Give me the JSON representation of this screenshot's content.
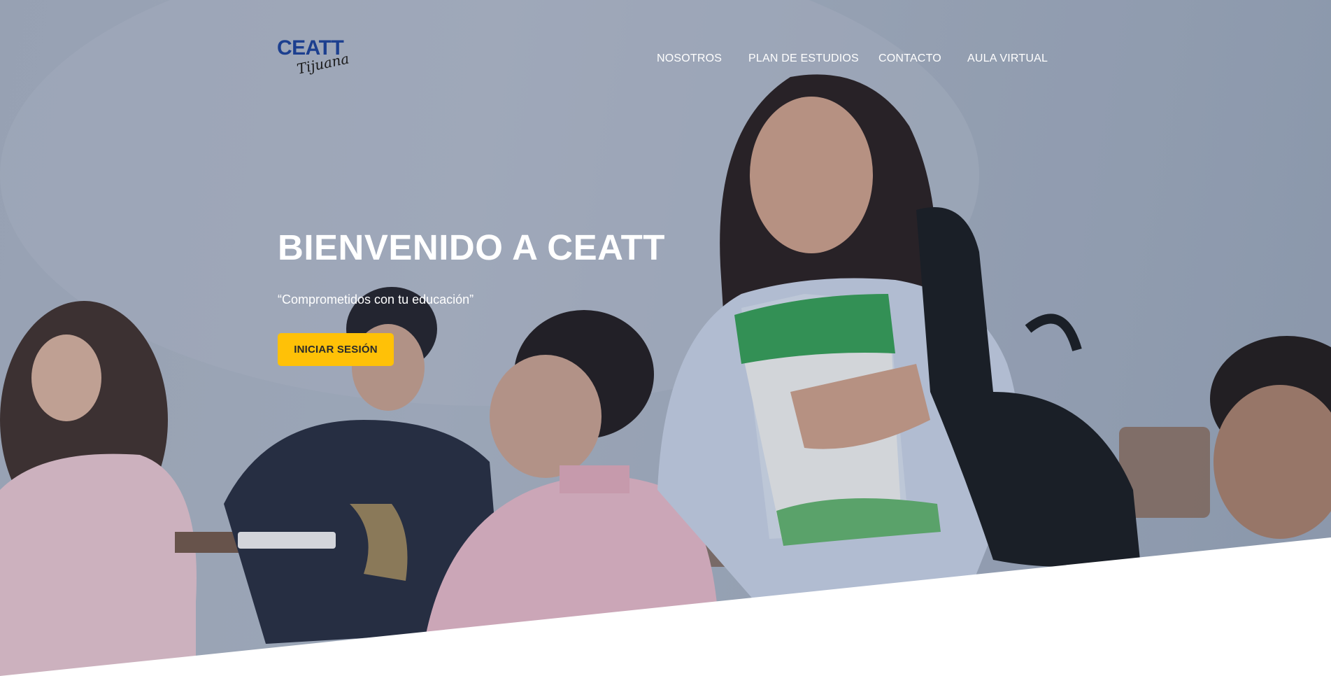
{
  "brand": {
    "name": "CEATT",
    "city": "Tijuana",
    "primary_color": "#1c3f8f"
  },
  "nav": {
    "items": [
      {
        "label": "NOSOTROS"
      },
      {
        "label": "PLAN DE ESTUDIOS"
      },
      {
        "label": "CONTACTO"
      },
      {
        "label": "AULA VIRTUAL"
      }
    ]
  },
  "hero": {
    "title": "BIENVENIDO A CEATT",
    "tagline": "“Comprometidos con tu educación”",
    "cta_label": "INICIAR SESIÓN",
    "cta_color": "#ffc107",
    "background": "photo-students-classroom"
  }
}
